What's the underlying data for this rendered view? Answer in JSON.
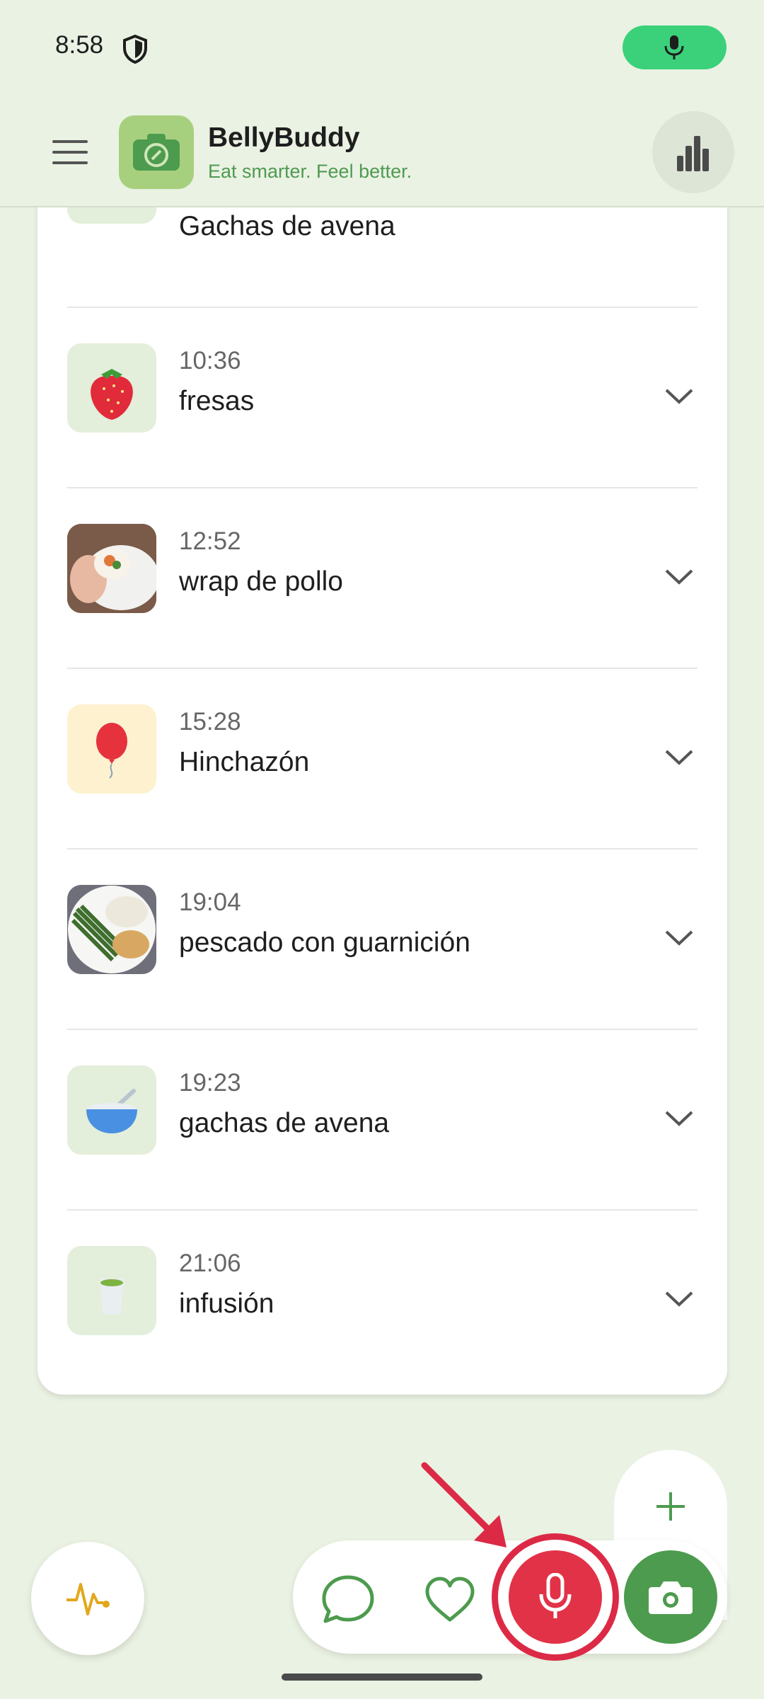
{
  "status_bar": {
    "time": "8:58"
  },
  "header": {
    "app_name": "BellyBuddy",
    "tagline": "Eat smarter. Feel better."
  },
  "entries": [
    {
      "time": "",
      "title": "Gachas de avena",
      "icon": "blue-bowl-icon"
    },
    {
      "time": "10:36",
      "title": "fresas",
      "icon": "strawberry-icon"
    },
    {
      "time": "12:52",
      "title": "wrap de pollo",
      "icon": "chicken-wrap-photo"
    },
    {
      "time": "15:28",
      "title": "Hinchazón",
      "icon": "balloon-icon"
    },
    {
      "time": "19:04",
      "title": "pescado con guarnición",
      "icon": "fish-plate-photo"
    },
    {
      "time": "19:23",
      "title": "gachas de avena",
      "icon": "bowl-icon"
    },
    {
      "time": "21:06",
      "title": "infusión",
      "icon": "tea-cup-icon"
    }
  ],
  "colors": {
    "background": "#eaf2e3",
    "accent_green": "#4d9b4e",
    "tagline_green": "#4f9a52",
    "record_red": "#e23247",
    "status_mic_green": "#3ad17a"
  }
}
